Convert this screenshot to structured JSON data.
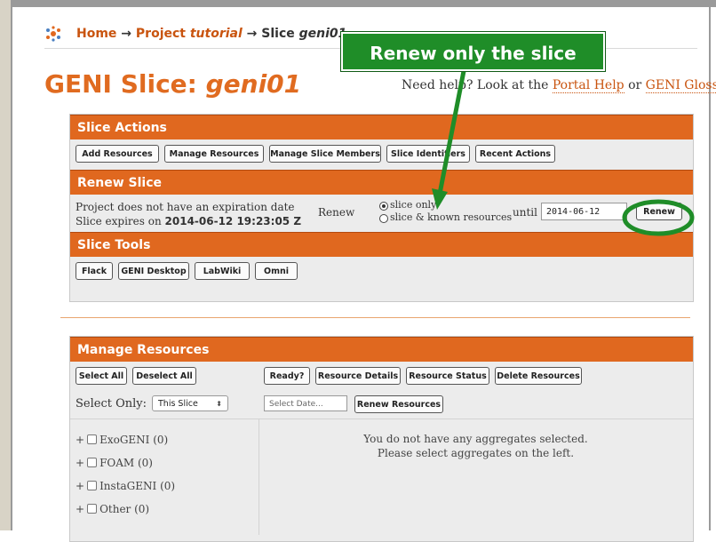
{
  "breadcrumb": {
    "home": "Home",
    "sep1": "→",
    "project_prefix": "Project",
    "project_name": "tutorial",
    "sep2": "→",
    "slice_prefix": "Slice",
    "slice_name": "geni01"
  },
  "page": {
    "title_prefix": "GENI Slice:",
    "title_name": "geni01",
    "help_prefix": "Need help? Look at the",
    "help_portal": "Portal Help",
    "help_or": "or",
    "help_glossary": "GENI Glossary",
    "help_end": "."
  },
  "callout": {
    "text": "Renew only the slice",
    "color": "#1f8d28"
  },
  "slice_actions": {
    "header": "Slice Actions",
    "buttons": [
      "Add Resources",
      "Manage Resources",
      "Manage Slice Members",
      "Slice Identifiers",
      "Recent Actions"
    ]
  },
  "renew_slice": {
    "header": "Renew Slice",
    "line1": "Project does not have an expiration date",
    "line2_prefix": "Slice expires on",
    "line2_date": "2014-06-12 19:23:05 Z",
    "renew_label": "Renew",
    "option_slice_only": "slice only",
    "option_slice_known": "slice & known resources",
    "until_label": "until",
    "until_value": "2014-06-12",
    "renew_button": "Renew"
  },
  "slice_tools": {
    "header": "Slice Tools",
    "buttons": [
      "Flack",
      "GENI Desktop",
      "LabWiki",
      "Omni"
    ]
  },
  "manage_resources": {
    "header": "Manage Resources",
    "buttons_left": [
      "Select All",
      "Deselect All"
    ],
    "buttons_right": [
      "Ready?",
      "Resource Details",
      "Resource Status",
      "Delete Resources"
    ],
    "select_only_label": "Select Only:",
    "select_only_value": "This Slice",
    "date_placeholder": "Select Date...",
    "renew_resources": "Renew Resources",
    "aggregates": [
      "ExoGENI (0)",
      "FOAM (0)",
      "InstaGENI (0)",
      "Other (0)"
    ],
    "message_line1": "You do not have any aggregates selected.",
    "message_line2": "Please select aggregates on the left."
  },
  "colors": {
    "accent": "#e0681f",
    "link": "#c9540f",
    "highlight": "#1f8d28"
  }
}
